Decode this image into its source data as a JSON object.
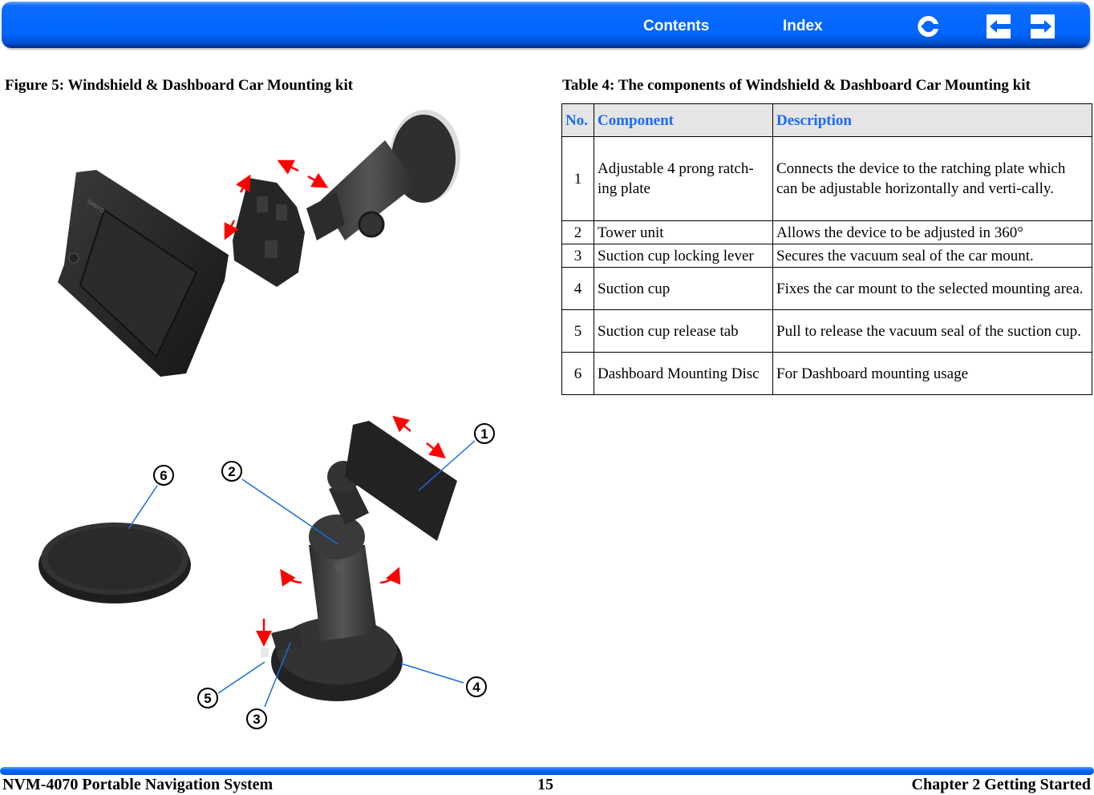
{
  "nav": {
    "contents_label": "Contents",
    "index_label": "Index",
    "icons": [
      "back-icon",
      "previous-page-icon",
      "next-page-icon"
    ],
    "bar_color": "#0066ff"
  },
  "figure": {
    "caption": "Figure 5: Windshield & Dashboard Car Mounting kit",
    "device_brand": "SANYO",
    "callouts": [
      "1",
      "2",
      "3",
      "4",
      "5",
      "6"
    ],
    "arrow_color": "#ff0000",
    "leader_color": "#1a6bdd"
  },
  "table": {
    "caption": "Table 4: The components of Windshield & Dashboard Car Mounting kit",
    "headers": {
      "no": "No.",
      "component": "Component",
      "description": "Description"
    },
    "header_color": "#1a6bff",
    "rows": [
      {
        "no": "1",
        "component": "Adjustable 4 prong ratch-ing plate",
        "description": "Connects the device to the ratching plate which can be adjustable horizontally and verti-cally."
      },
      {
        "no": "2",
        "component": "Tower unit",
        "description": "Allows the device to be adjusted in 360°"
      },
      {
        "no": "3",
        "component": "Suction cup locking lever",
        "description": "Secures the vacuum seal of the car mount."
      },
      {
        "no": "4",
        "component": "Suction cup",
        "description": "Fixes the car mount to the selected mounting area."
      },
      {
        "no": "5",
        "component": "Suction cup release tab",
        "description": "Pull to release the vacuum seal of the suction cup."
      },
      {
        "no": "6",
        "component": "Dashboard Mounting Disc",
        "description": "For Dashboard mounting usage"
      }
    ]
  },
  "footer": {
    "title": "NVM-4070 Portable Navigation System",
    "page_number": "15",
    "chapter": "Chapter 2 Getting Started"
  }
}
